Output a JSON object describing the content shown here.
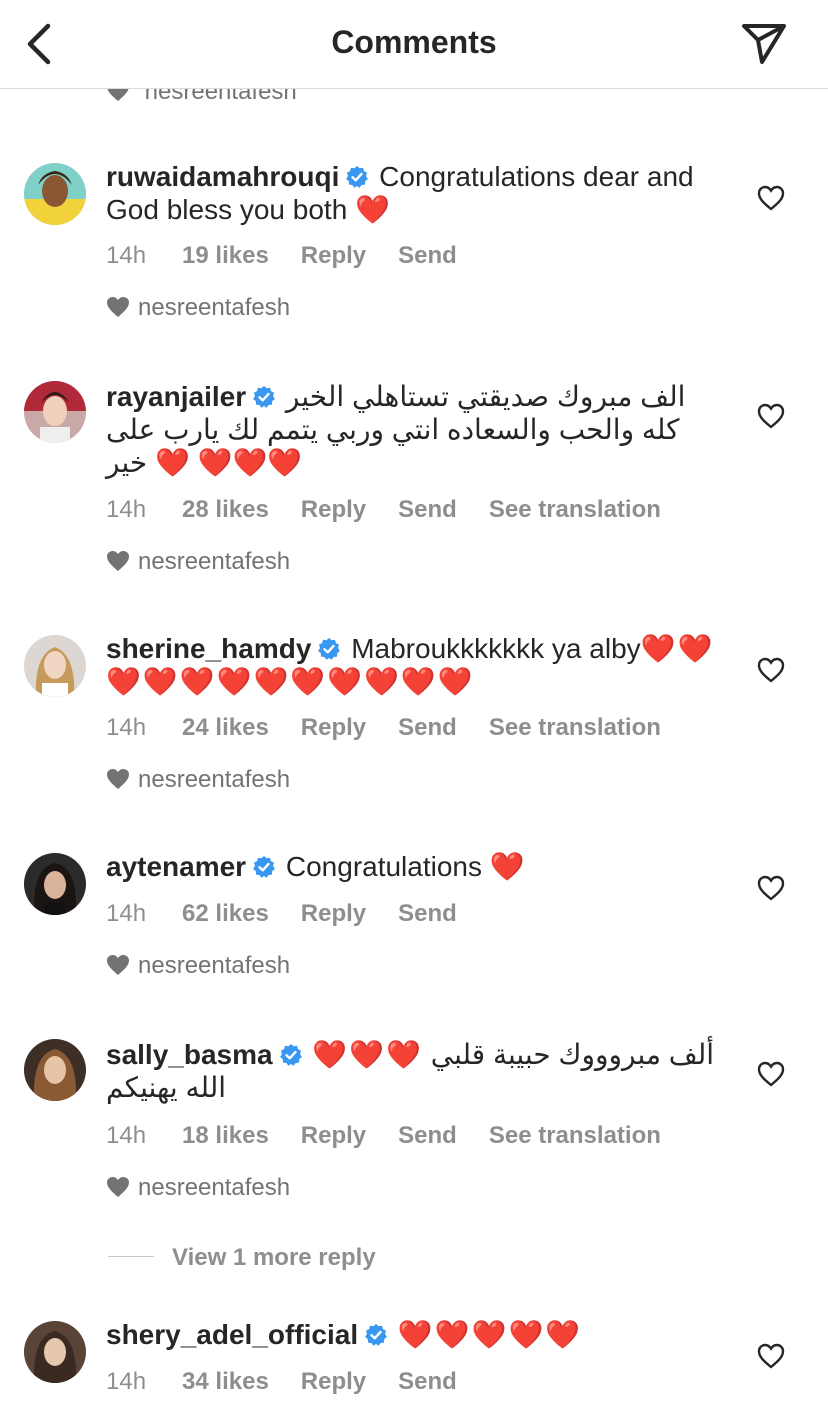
{
  "header": {
    "title": "Comments"
  },
  "peek_user": "nesreentafesh",
  "comments": [
    {
      "username": "ruwaidamahrouqi",
      "text": "Congratulations dear and God bless you both",
      "text_hearts": "❤️",
      "time": "14h",
      "likes": "19 likes",
      "reply": "Reply",
      "send": "Send",
      "liked_by": "nesreentafesh"
    },
    {
      "username": "rayanjailer",
      "text": "الف مبروك صديقتي تستاهلي الخير كله والحب والسعاده انتي وربي يتمم لك يارب على خير",
      "text_hearts": "❤️ ❤️❤️❤️",
      "time": "14h",
      "likes": "28 likes",
      "reply": "Reply",
      "send": "Send",
      "translate": "See translation",
      "liked_by": "nesreentafesh"
    },
    {
      "username": "sherine_hamdy",
      "text": "Mabroukkkkkkk ya alby",
      "text_hearts": "❤️❤️❤️❤️❤️❤️❤️❤️❤️❤️❤️❤️",
      "time": "14h",
      "likes": "24 likes",
      "reply": "Reply",
      "send": "Send",
      "translate": "See translation",
      "liked_by": "nesreentafesh"
    },
    {
      "username": "aytenamer",
      "text": "Congratulations",
      "text_hearts": "❤️",
      "time": "14h",
      "likes": "62 likes",
      "reply": "Reply",
      "send": "Send",
      "liked_by": "nesreentafesh"
    },
    {
      "username": "sally_basma",
      "text": "ألف مبروووك حبيبة قلبي الله يهنيكم",
      "text_hearts": "❤️❤️❤️",
      "time": "14h",
      "likes": "18 likes",
      "reply": "Reply",
      "send": "Send",
      "translate": "See translation",
      "liked_by": "nesreentafesh"
    },
    {
      "username": "shery_adel_official",
      "text": "",
      "text_hearts": "❤️❤️❤️❤️❤️",
      "time": "14h",
      "likes": "34 likes",
      "reply": "Reply",
      "send": "Send"
    }
  ],
  "view_more": "View 1 more reply",
  "colors": {
    "verified": "#3897f0",
    "heart": "#ed1c2e",
    "meta": "#8e8e8e"
  }
}
